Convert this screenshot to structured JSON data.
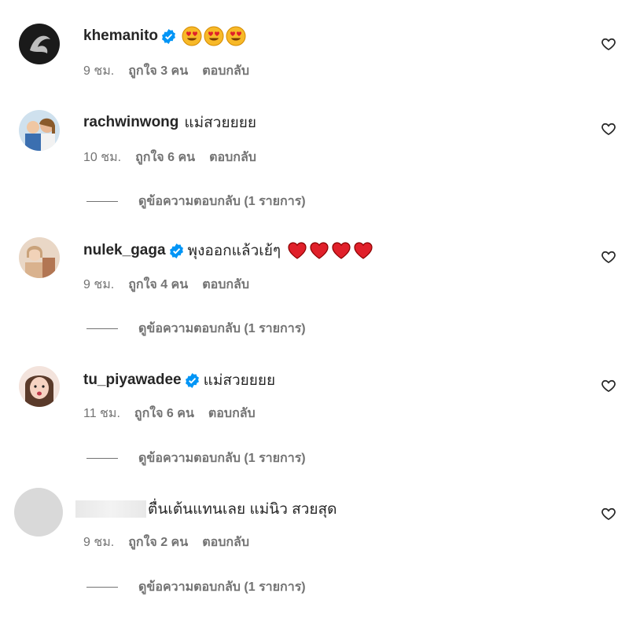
{
  "comments": [
    {
      "username": "khemanito",
      "verified": true,
      "text": "",
      "emoji": [
        "heart-eyes",
        "heart-eyes",
        "heart-eyes"
      ],
      "time": "9 ชม.",
      "likes": "ถูกใจ 3 คน",
      "reply": "ตอบกลับ",
      "view_replies": ""
    },
    {
      "username": "rachwinwong",
      "verified": false,
      "text": "แม่สวยยยย",
      "time": "10 ชม.",
      "likes": "ถูกใจ 6 คน",
      "reply": "ตอบกลับ",
      "view_replies": "ดูข้อความตอบกลับ (1 รายการ)"
    },
    {
      "username": "nulek_gaga",
      "verified": true,
      "text": "พุงออกแล้วเย้ๆ",
      "emoji": [
        "red-heart",
        "red-heart",
        "red-heart",
        "red-heart"
      ],
      "time": "9 ชม.",
      "likes": "ถูกใจ 4 คน",
      "reply": "ตอบกลับ",
      "view_replies": "ดูข้อความตอบกลับ (1 รายการ)"
    },
    {
      "username": "tu_piyawadee",
      "verified": true,
      "text": "แม่สวยยยย",
      "time": "11 ชม.",
      "likes": "ถูกใจ 6 คน",
      "reply": "ตอบกลับ",
      "view_replies": "ดูข้อความตอบกลับ (1 รายการ)"
    },
    {
      "username": "",
      "verified": false,
      "text": "ตื่นเต้นแทนเลย แม่นิว สวยสุด",
      "time": "9 ชม.",
      "likes": "ถูกใจ 2 คน",
      "reply": "ตอบกลับ",
      "view_replies": "ดูข้อความตอบกลับ (1 รายการ)"
    }
  ],
  "colors": {
    "verified": "#0095f6",
    "meta": "#737373",
    "heart": "#e0202a"
  }
}
